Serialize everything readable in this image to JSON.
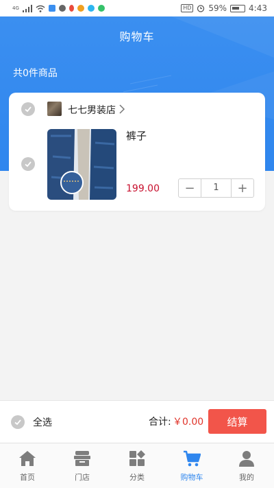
{
  "status_bar": {
    "network": "4G",
    "hd": "HD",
    "battery": "59%",
    "time": "4:43"
  },
  "header": {
    "title": "购物车",
    "item_count": "共0件商品"
  },
  "shop": {
    "name": "七七男装店",
    "item": {
      "name": "裤子",
      "price": "199.00",
      "quantity": "1",
      "minus": "−",
      "plus": "+"
    }
  },
  "checkout": {
    "select_all": "全选",
    "total_label": "合计:",
    "total_value": "￥0.00",
    "button": "结算"
  },
  "tabs": [
    {
      "label": "首页",
      "icon": "home-icon"
    },
    {
      "label": "门店",
      "icon": "store-icon"
    },
    {
      "label": "分类",
      "icon": "category-icon"
    },
    {
      "label": "购物车",
      "icon": "cart-icon"
    },
    {
      "label": "我的",
      "icon": "user-icon"
    }
  ],
  "colors": {
    "primary": "#2f86ee",
    "price": "#c8102e",
    "total": "#e0342a",
    "checkout_button": "#f2554a"
  }
}
